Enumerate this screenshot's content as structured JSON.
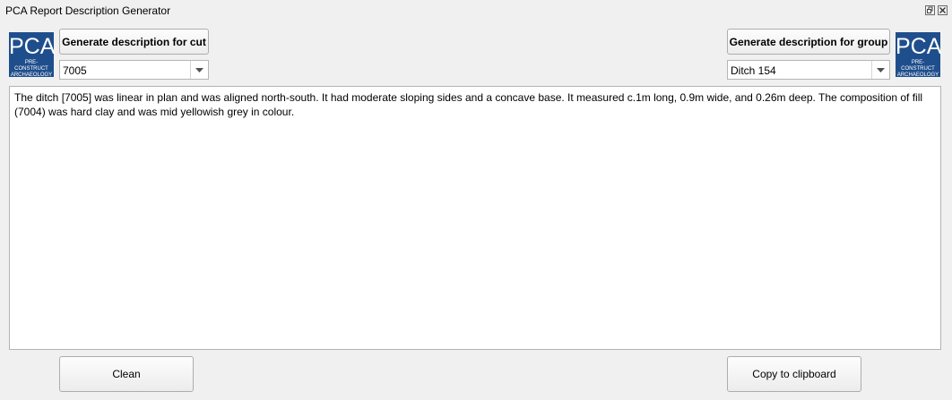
{
  "window": {
    "title": "PCA Report Description Generator",
    "restore_icon": "restore-icon",
    "close_icon": "close-icon"
  },
  "logo": {
    "text": "PCA",
    "subtext_line1": "PRE-CONSTRUCT",
    "subtext_line2": "ARCHAEOLOGY",
    "color": "#1f4e8c"
  },
  "cut": {
    "button_label": "Generate description for cut",
    "selected_value": "7005"
  },
  "group": {
    "button_label": "Generate description for group",
    "selected_value": "Ditch 154"
  },
  "description": {
    "text": "The ditch [7005] was linear in plan and was aligned north-south. It had moderate sloping sides and a concave base. It measured c.1m long, 0.9m wide, and 0.26m deep. The composition of fill (7004) was hard clay and was mid yellowish grey in colour."
  },
  "footer": {
    "clean_label": "Clean",
    "copy_label": "Copy to clipboard"
  }
}
